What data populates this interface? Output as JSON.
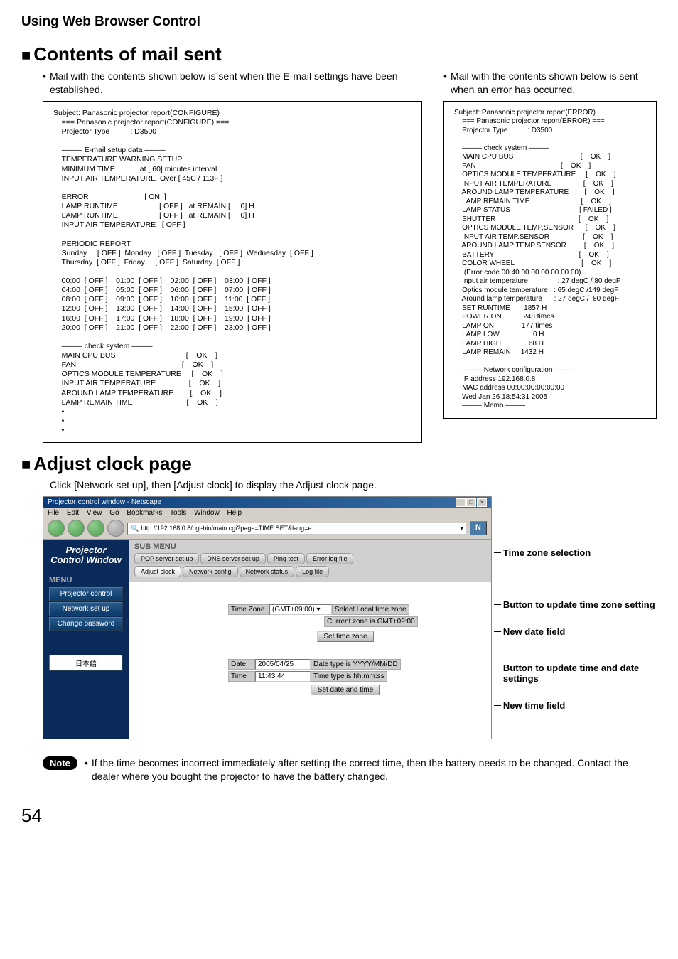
{
  "header": {
    "title": "Using Web Browser Control"
  },
  "mailSection": {
    "title": "Contents of mail sent",
    "leftIntro": "Mail with the contents shown below is sent when the E-mail settings have been established.",
    "rightIntro": "Mail with the contents shown below is sent when an error has occurred.",
    "configureMail": "Subject: Panasonic projector report(CONFIGURE)\n    === Panasonic projector report(CONFIGURE) ===\n    Projector Type          : D3500\n\n    ––––– E-mail setup data –––––\n    TEMPERATURE WARNING SETUP \n    MINIMUM TIME            at [ 60] minutes interval \n    INPUT AIR TEMPERATURE  Over [ 45C / 113F ] \n\n    ERROR                           [ ON  ]\n    LAMP RUNTIME                    [ OFF ]   at REMAIN [     0] H \n    LAMP RUNTIME                    [ OFF ]   at REMAIN [     0] H \n    INPUT AIR TEMPERATURE   [ OFF ] \n\n    PERIODIC REPORT \n    Sunday     [ OFF ]  Monday   [ OFF ]  Tuesday   [ OFF ]  Wednesday  [ OFF ] \n    Thursday  [ OFF ]  Friday     [ OFF ]  Saturday  [ OFF ] \n\n    00:00  [ OFF ]    01:00  [ OFF ]    02:00  [ OFF ]    03:00  [ OFF ] \n    04:00  [ OFF ]    05:00  [ OFF ]    06:00  [ OFF ]    07:00  [ OFF ] \n    08:00  [ OFF ]    09:00  [ OFF ]    10:00  [ OFF ]    11:00  [ OFF ] \n    12:00  [ OFF ]    13:00  [ OFF ]    14:00  [ OFF ]    15:00  [ OFF ] \n    16:00  [ OFF ]    17:00  [ OFF ]    18:00  [ OFF ]    19:00  [ OFF ] \n    20:00  [ OFF ]    21:00  [ OFF ]    22:00  [ OFF ]    23:00  [ OFF ] \n\n    ––––– check system –––––\n    MAIN CPU BUS                                  [    OK    ]\n    FAN                                                   [    OK    ]\n    OPTICS MODULE TEMPERATURE     [    OK    ]\n    INPUT AIR TEMPERATURE                [    OK    ]\n    AROUND LAMP TEMPERATURE        [    OK    ]\n    LAMP REMAIN TIME                          [    OK    ]\n    •\n    •\n    •",
    "errorMail": "Subject: Panasonic projector report(ERROR)\n    === Panasonic projector report(ERROR) ===\n    Projector Type          : D3500\n\n    ––––– check system –––––\n    MAIN CPU BUS                                  [    OK    ]\n    FAN                                           [    OK    ]\n    OPTICS MODULE TEMPERATURE     [    OK    ]\n    INPUT AIR TEMPERATURE                [    OK    ]\n    AROUND LAMP TEMPERATURE        [    OK    ]\n    LAMP REMAIN TIME                          [    OK    ]\n    LAMP STATUS                                   [ FAILED ]\n    SHUTTER                                          [    OK    ]\n    OPTICS MODULE TEMP.SENSOR      [    OK    ]\n    INPUT AIR TEMP.SENSOR                 [    OK    ]\n    AROUND LAMP TEMP.SENSOR         [    OK    ]\n    BATTERY                                           [    OK    ]\n    COLOR WHEEL                                  [    OK    ]\n     (Error code 00 40 00 00 00 00 00 00)\n    Input air temperature               : 27 degC / 80 degF\n    Optics module temperature   : 65 degC /149 degF\n    Around lamp temperature      : 27 degC /  80 degF\n    SET RUNTIME       1857 H\n    POWER ON           248 times\n    LAMP ON              177 times\n    LAMP LOW                 0 H\n    LAMP HIGH              68 H\n    LAMP REMAIN     1432 H\n\n    ––––– Network configuration –––––\n    IP address 192.168.0.8\n    MAC address 00:00:00:00:00:00\n    Wed Jan 26 18:54:31 2005\n    ––––– Memo –––––"
  },
  "clockSection": {
    "title": "Adjust clock page",
    "desc": "Click [Network set up], then [Adjust clock] to display the Adjust clock page."
  },
  "browser": {
    "title": "Projector control window - Netscape",
    "menus": {
      "file": "File",
      "edit": "Edit",
      "view": "View",
      "go": "Go",
      "bookmarks": "Bookmarks",
      "tools": "Tools",
      "window": "Window",
      "help": "Help"
    },
    "url": "http://192.168.0.8/cgi-bin/main.cgi?page=TIME SET&lang=e",
    "sidebar": {
      "header": "Projector Control Window",
      "menuLabel": "MENU",
      "items": {
        "pc": "Projector control",
        "ns": "Network set up",
        "cp": "Change password",
        "jp": "日本語"
      }
    },
    "submenu": {
      "title": "SUB MENU",
      "tabs": {
        "pop": "POP server set up",
        "dns": "DNS server set up",
        "ping": "Ping test",
        "err": "Error log file",
        "clock": "Adjust clock",
        "ncfg": "Network config",
        "nstat": "Network status",
        "log": "Log file"
      }
    },
    "form": {
      "tzLabel": "Time Zone",
      "tzValue": "(GMT+09:00)",
      "tzNote1": "Select Local time zone",
      "tzNote2": "Current zone is GMT+09:00",
      "tzBtn": "Set time zone",
      "dateLabel": "Date",
      "dateValue": "2005/04/25",
      "dateNote": "Date type is YYYY/MM/DD",
      "timeLabel": "Time",
      "timeValue": "11:43:44",
      "timeNote": "Time type is hh:mm:ss",
      "dtBtn": "Set date and time"
    }
  },
  "annotations": {
    "tz": "Time zone selection",
    "tzbtn": "Button to update time zone setting",
    "date": "New date field",
    "dtbtn": "Button to update time and date settings",
    "time": "New time field"
  },
  "note": {
    "label": "Note",
    "text": "If the time becomes incorrect immediately after setting the correct time, then the battery needs to be changed. Contact the dealer where you bought the projector to have the battery changed."
  },
  "pageNum": "54"
}
